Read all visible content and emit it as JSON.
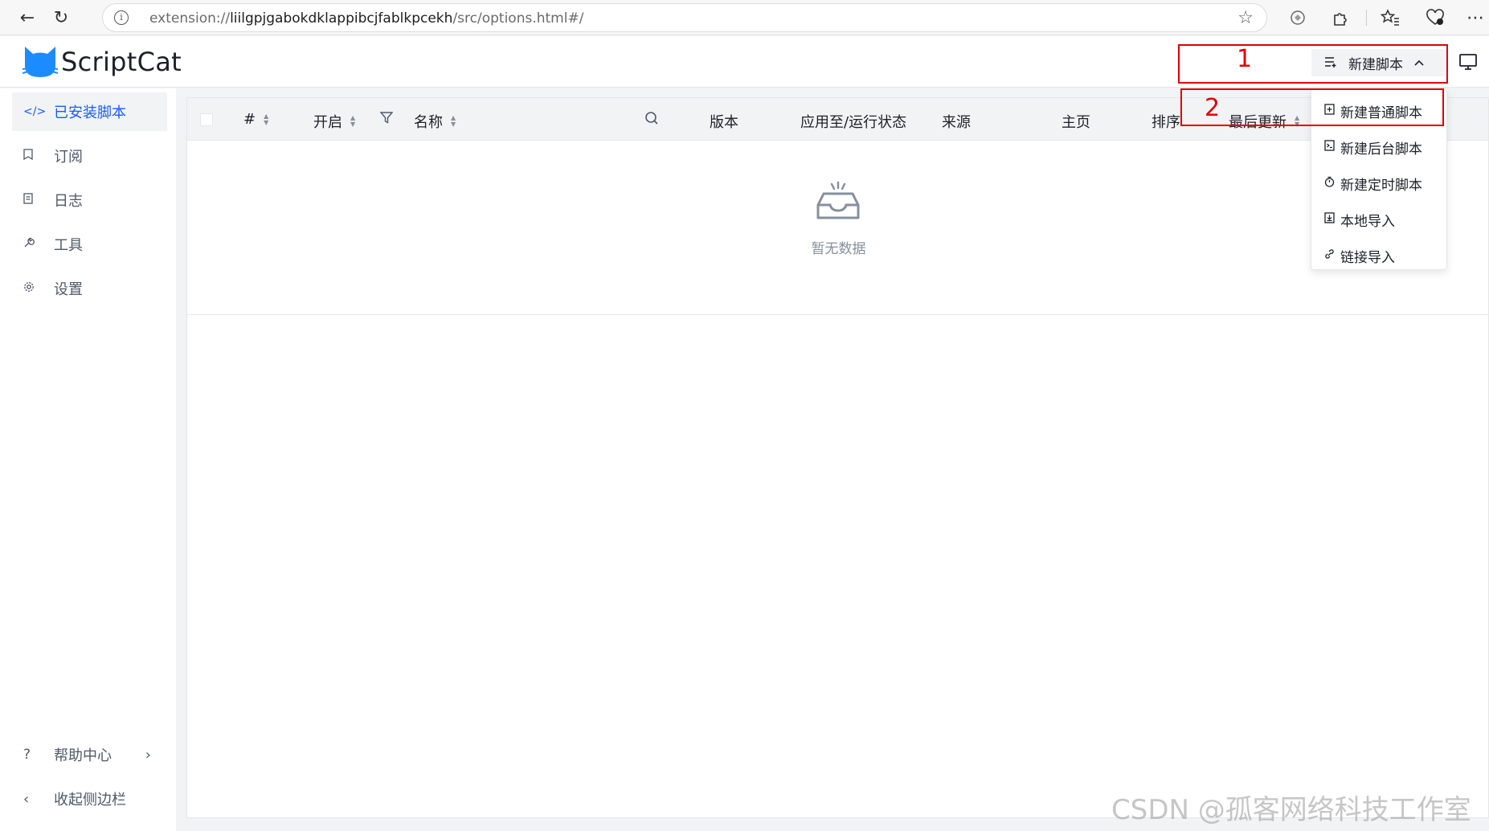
{
  "browser": {
    "url_prefix": "extension://",
    "url_host": "liilgpjgabokdklappibcjfablkpcekh",
    "url_path": "/src/options.html#/"
  },
  "app": {
    "name": "ScriptCat",
    "brand_color": "#1a8cff",
    "new_script_label": "新建脚本"
  },
  "sidebar": {
    "items": [
      {
        "label": "已安装脚本",
        "icon": "code-icon",
        "active": true
      },
      {
        "label": "订阅",
        "icon": "bookmark-icon"
      },
      {
        "label": "日志",
        "icon": "file-icon"
      },
      {
        "label": "工具",
        "icon": "wrench-icon"
      },
      {
        "label": "设置",
        "icon": "gear-icon"
      }
    ],
    "help_label": "帮助中心",
    "collapse_label": "收起侧边栏"
  },
  "table": {
    "columns": {
      "index": "#",
      "enabled": "开启",
      "name": "名称",
      "version": "版本",
      "status": "应用至/运行状态",
      "source": "来源",
      "homepage": "主页",
      "order": "排序",
      "updated": "最后更新"
    },
    "empty_text": "暂无数据"
  },
  "dropdown": {
    "items": [
      {
        "label": "新建普通脚本",
        "icon": "file-plus-icon"
      },
      {
        "label": "新建后台脚本",
        "icon": "terminal-icon"
      },
      {
        "label": "新建定时脚本",
        "icon": "timer-icon"
      },
      {
        "label": "本地导入",
        "icon": "import-icon"
      },
      {
        "label": "链接导入",
        "icon": "link-icon"
      }
    ]
  },
  "annotations": {
    "first": "1",
    "second": "2",
    "color": "#e00000"
  },
  "watermark": "CSDN @孤客网络科技工作室"
}
